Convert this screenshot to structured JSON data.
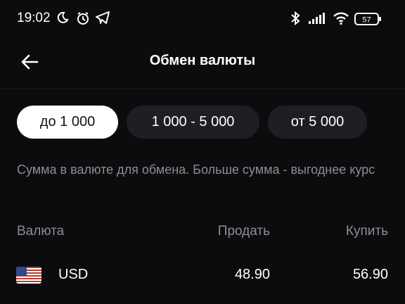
{
  "status_bar": {
    "time": "19:02",
    "battery": "57",
    "left_icons": [
      "moon-icon",
      "alarm-icon",
      "telegram-icon"
    ],
    "right_icons": [
      "bluetooth-icon",
      "signal-icon",
      "wifi-icon",
      "battery-icon"
    ]
  },
  "header": {
    "title": "Обмен валюты",
    "back_icon": "arrow-left-icon"
  },
  "amount_filters": [
    {
      "label": "до 1 000",
      "selected": true
    },
    {
      "label": "1 000 - 5 000",
      "selected": false
    },
    {
      "label": "от 5 000",
      "selected": false
    }
  ],
  "hint": "Сумма в валюте для обмена. Больше сумма - выгоднее курс",
  "table": {
    "headers": {
      "currency": "Валюта",
      "sell": "Продать",
      "buy": "Купить"
    },
    "rows": [
      {
        "flag_icon": "us-flag-icon",
        "currency": "USD",
        "sell": "48.90",
        "buy": "56.90"
      }
    ]
  },
  "colors": {
    "background": "#0c0c0e",
    "chip": "#1f1f23",
    "chip_active": "#ffffff",
    "muted_text": "#8d8d93"
  }
}
